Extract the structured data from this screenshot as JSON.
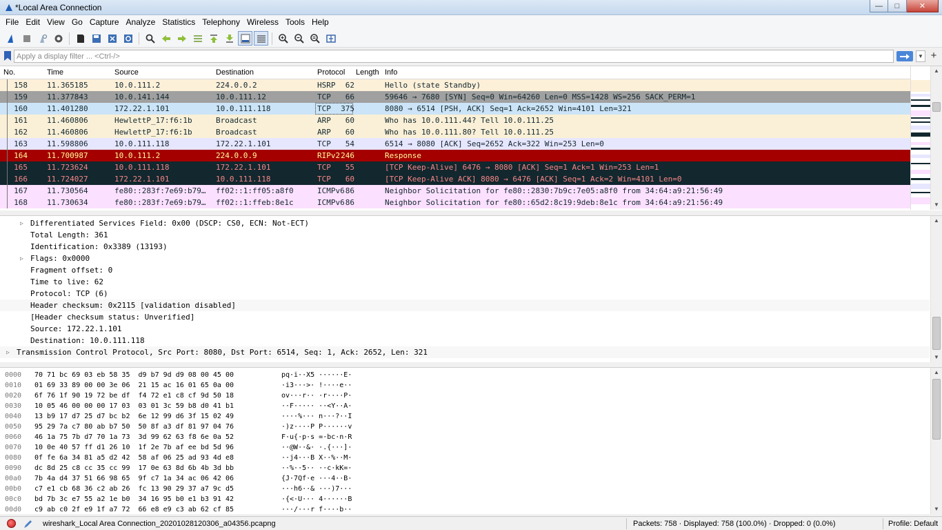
{
  "window": {
    "title": "*Local Area Connection",
    "minimize": "—",
    "maximize": "□",
    "close": "✕"
  },
  "menu": [
    "File",
    "Edit",
    "View",
    "Go",
    "Capture",
    "Analyze",
    "Statistics",
    "Telephony",
    "Wireless",
    "Tools",
    "Help"
  ],
  "filter": {
    "placeholder": "Apply a display filter ... <Ctrl-/>",
    "value": "",
    "dropdown": "▼",
    "add": "+"
  },
  "columns": {
    "no": "No.",
    "time": "Time",
    "source": "Source",
    "destination": "Destination",
    "protocol": "Protocol",
    "length": "Length",
    "info": "Info"
  },
  "packets": [
    {
      "no": "158",
      "time": "11.365185",
      "src": "10.0.111.2",
      "dst": "224.0.0.2",
      "proto": "HSRP",
      "len": "62",
      "info": "Hello (state Standby)",
      "bg": "#fdf0d9",
      "fg": "#12272e"
    },
    {
      "no": "159",
      "time": "11.377843",
      "src": "10.0.141.144",
      "dst": "10.0.111.12",
      "proto": "TCP",
      "len": "66",
      "info": "59646 → 7680 [SYN] Seq=0 Win=64260 Len=0 MSS=1428 WS=256 SACK_PERM=1",
      "bg": "#a0a0a0",
      "fg": "#12272e"
    },
    {
      "no": "160",
      "time": "11.401280",
      "src": "172.22.1.101",
      "dst": "10.0.111.118",
      "proto": "TCP",
      "len": "375",
      "info": "8080 → 6514 [PSH, ACK] Seq=1 Ack=2652 Win=4101 Len=321",
      "bg": "#cce4f7",
      "fg": "#12272e",
      "selected": true
    },
    {
      "no": "161",
      "time": "11.460806",
      "src": "HewlettP_17:f6:1b",
      "dst": "Broadcast",
      "proto": "ARP",
      "len": "60",
      "info": "Who has 10.0.111.44? Tell 10.0.111.25",
      "bg": "#faf0d7",
      "fg": "#12272e"
    },
    {
      "no": "162",
      "time": "11.460806",
      "src": "HewlettP_17:f6:1b",
      "dst": "Broadcast",
      "proto": "ARP",
      "len": "60",
      "info": "Who has 10.0.111.80? Tell 10.0.111.25",
      "bg": "#faf0d7",
      "fg": "#12272e"
    },
    {
      "no": "163",
      "time": "11.598806",
      "src": "10.0.111.118",
      "dst": "172.22.1.101",
      "proto": "TCP",
      "len": "54",
      "info": "6514 → 8080 [ACK] Seq=2652 Ack=322 Win=253 Len=0",
      "bg": "#e7e6ff",
      "fg": "#12272e"
    },
    {
      "no": "164",
      "time": "11.700987",
      "src": "10.0.111.2",
      "dst": "224.0.0.9",
      "proto": "RIPv2",
      "len": "246",
      "info": "Response",
      "bg": "#a40000",
      "fg": "#fffc9c"
    },
    {
      "no": "165",
      "time": "11.723624",
      "src": "10.0.111.118",
      "dst": "172.22.1.101",
      "proto": "TCP",
      "len": "55",
      "info": "[TCP Keep-Alive] 6476 → 8080 [ACK] Seq=1 Ack=1 Win=253 Len=1",
      "bg": "#12272e",
      "fg": "#f78787"
    },
    {
      "no": "166",
      "time": "11.724027",
      "src": "172.22.1.101",
      "dst": "10.0.111.118",
      "proto": "TCP",
      "len": "60",
      "info": "[TCP Keep-Alive ACK] 8080 → 6476 [ACK] Seq=1 Ack=2 Win=4101 Len=0",
      "bg": "#12272e",
      "fg": "#f78787"
    },
    {
      "no": "167",
      "time": "11.730564",
      "src": "fe80::283f:7e69:b79…",
      "dst": "ff02::1:ff05:a8f0",
      "proto": "ICMPv6",
      "len": "86",
      "info": "Neighbor Solicitation for fe80::2830:7b9c:7e05:a8f0 from 34:64:a9:21:56:49",
      "bg": "#fce0ff",
      "fg": "#12272e"
    },
    {
      "no": "168",
      "time": "11.730634",
      "src": "fe80::283f:7e69:b79…",
      "dst": "ff02::1:ffeb:8e1c",
      "proto": "ICMPv6",
      "len": "86",
      "info": "Neighbor Solicitation for fe80::65d2:8c19:9deb:8e1c from 34:64:a9:21:56:49",
      "bg": "#fce0ff",
      "fg": "#12272e"
    }
  ],
  "details": [
    {
      "text": "Differentiated Services Field: 0x00 (DSCP: CS0, ECN: Not-ECT)",
      "indent": 1,
      "expandable": true
    },
    {
      "text": "Total Length: 361",
      "indent": 1
    },
    {
      "text": "Identification: 0x3389 (13193)",
      "indent": 1
    },
    {
      "text": "Flags: 0x0000",
      "indent": 1,
      "expandable": true
    },
    {
      "text": "Fragment offset: 0",
      "indent": 1
    },
    {
      "text": "Time to live: 62",
      "indent": 1
    },
    {
      "text": "Protocol: TCP (6)",
      "indent": 1
    },
    {
      "text": "Header checksum: 0x2115 [validation disabled]",
      "indent": 1,
      "highlight": true
    },
    {
      "text": "[Header checksum status: Unverified]",
      "indent": 1
    },
    {
      "text": "Source: 172.22.1.101",
      "indent": 1
    },
    {
      "text": "Destination: 10.0.111.118",
      "indent": 1
    },
    {
      "text": "Transmission Control Protocol, Src Port: 8080, Dst Port: 6514, Seq: 1, Ack: 2652, Len: 321",
      "indent": 0,
      "expandable": true,
      "highlight": true
    }
  ],
  "hex": [
    {
      "off": "0000",
      "bytes": "70 71 bc 69 03 eb 58 35  d9 b7 9d d9 08 00 45 00",
      "ascii": "pq·i··X5 ······E·"
    },
    {
      "off": "0010",
      "bytes": "01 69 33 89 00 00 3e 06  21 15 ac 16 01 65 0a 00",
      "ascii": "·i3···>· !····e··"
    },
    {
      "off": "0020",
      "bytes": "6f 76 1f 90 19 72 be df  f4 72 e1 c8 cf 9d 50 18",
      "ascii": "ov···r·· ·r····P·"
    },
    {
      "off": "0030",
      "bytes": "10 05 46 00 00 00 17 03  03 01 3c 59 b8 d0 41 b1",
      "ascii": "··F····· ··<Y··A·"
    },
    {
      "off": "0040",
      "bytes": "13 b9 17 d7 25 d7 bc b2  6e 12 99 d6 3f 15 02 49",
      "ascii": "····%··· n···?··I"
    },
    {
      "off": "0050",
      "bytes": "95 29 7a c7 80 ab b7 50  50 8f a3 df 81 97 04 76",
      "ascii": "·)z····P P······v"
    },
    {
      "off": "0060",
      "bytes": "46 1a 75 7b d7 70 1a 73  3d 99 62 63 f8 6e 0a 52",
      "ascii": "F·u{·p·s =·bc·n·R"
    },
    {
      "off": "0070",
      "bytes": "10 0e 40 57 ff d1 26 10  1f 2e 7b af ee bd 5d 96",
      "ascii": "··@W··&· ·.{···]·"
    },
    {
      "off": "0080",
      "bytes": "0f fe 6a 34 81 a5 d2 42  58 af 06 25 ad 93 4d e8",
      "ascii": "··j4···B X··%··M·"
    },
    {
      "off": "0090",
      "bytes": "dc 8d 25 c8 cc 35 cc 99  17 0e 63 8d 6b 4b 3d bb",
      "ascii": "··%··5·· ··c·kK=·"
    },
    {
      "off": "00a0",
      "bytes": "7b 4a d4 37 51 66 98 65  9f c7 1a 34 ac 06 42 06",
      "ascii": "{J·7Qf·e ···4··B·"
    },
    {
      "off": "00b0",
      "bytes": "c7 e1 cb 68 36 c2 ab 26  fc 13 90 29 37 a7 9c d5",
      "ascii": "···h6··& ···)7···"
    },
    {
      "off": "00c0",
      "bytes": "bd 7b 3c e7 55 a2 1e b0  34 16 95 b0 e1 b3 91 42",
      "ascii": "·{<·U··· 4······B"
    },
    {
      "off": "00d0",
      "bytes": "c9 ab c0 2f e9 1f a7 72  66 e8 e9 c3 ab 62 cf 85",
      "ascii": "···/···r f····b··"
    }
  ],
  "status": {
    "file": "wireshark_Local Area Connection_20201028120306_a04356.pcapng",
    "packets": "Packets: 758 · Displayed: 758 (100.0%) · Dropped: 0 (0.0%)",
    "profile": "Profile: Default"
  }
}
